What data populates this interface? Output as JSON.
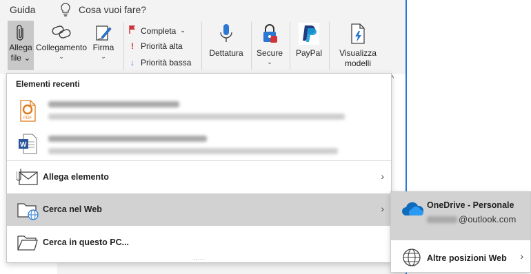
{
  "menubar": {
    "guida": "Guida",
    "search_hint": "Cosa vuoi fare?",
    "icons": {
      "tell_me": "lightbulb-icon"
    }
  },
  "ribbon": {
    "attach": {
      "line1": "Allega",
      "line2": "file",
      "chev": "⌄",
      "icon": "paperclip-icon"
    },
    "link": {
      "label": "Collegamento",
      "chev": "⌄",
      "icon": "link-icon"
    },
    "signature": {
      "label": "Firma",
      "chev": "⌄",
      "icon": "signature-pen-icon"
    },
    "followup": {
      "label": "Completa",
      "chev": "⌄",
      "icon": "red-flag-icon"
    },
    "high_priority": {
      "label": "Priorità alta",
      "icon": "exclamation-icon"
    },
    "low_priority": {
      "label": "Priorità bassa",
      "icon": "down-arrow-icon"
    },
    "dictate": {
      "label": "Dettatura",
      "icon": "microphone-icon"
    },
    "secure": {
      "label": "Secure",
      "chev": "⌄",
      "icon": "padlock-icon"
    },
    "paypal": {
      "label": "PayPal",
      "icon": "paypal-icon"
    },
    "view_templates": {
      "line1": "Visualizza",
      "line2": "modelli",
      "icon": "template-icon"
    },
    "collapse_chevron": "^"
  },
  "dropdown": {
    "title": "Elementi recenti",
    "recent_items": [
      {
        "type": "pdf",
        "icon": "pdf-file-icon",
        "name_blurred": true,
        "path_blurred": true
      },
      {
        "type": "word",
        "icon": "word-file-icon",
        "name_blurred": true,
        "path_blurred": true
      }
    ],
    "actions": [
      {
        "label": "Allega elemento",
        "icon": "envelope-icon",
        "arrow": "›",
        "highlighted": false
      },
      {
        "label": "Cerca nel Web",
        "icon": "web-folder-icon",
        "arrow": "›",
        "highlighted": true
      },
      {
        "label": "Cerca in questo PC...",
        "icon": "folder-icon",
        "arrow": "",
        "highlighted": false
      }
    ],
    "grip": "....."
  },
  "submenu": {
    "onedrive_title": "OneDrive - Personale",
    "onedrive_email_suffix": "@outlook.com",
    "other_locations": "Altre posizioni Web",
    "arrow": "›"
  },
  "colors": {
    "accent_blue": "#2b78d4",
    "flag_red": "#d13438",
    "highlight_gray": "#d2d2d2",
    "paypal_navy": "#253b80",
    "paypal_blue": "#179bd7",
    "word_blue": "#2b579a",
    "pdf_orange": "#e07a1b"
  }
}
